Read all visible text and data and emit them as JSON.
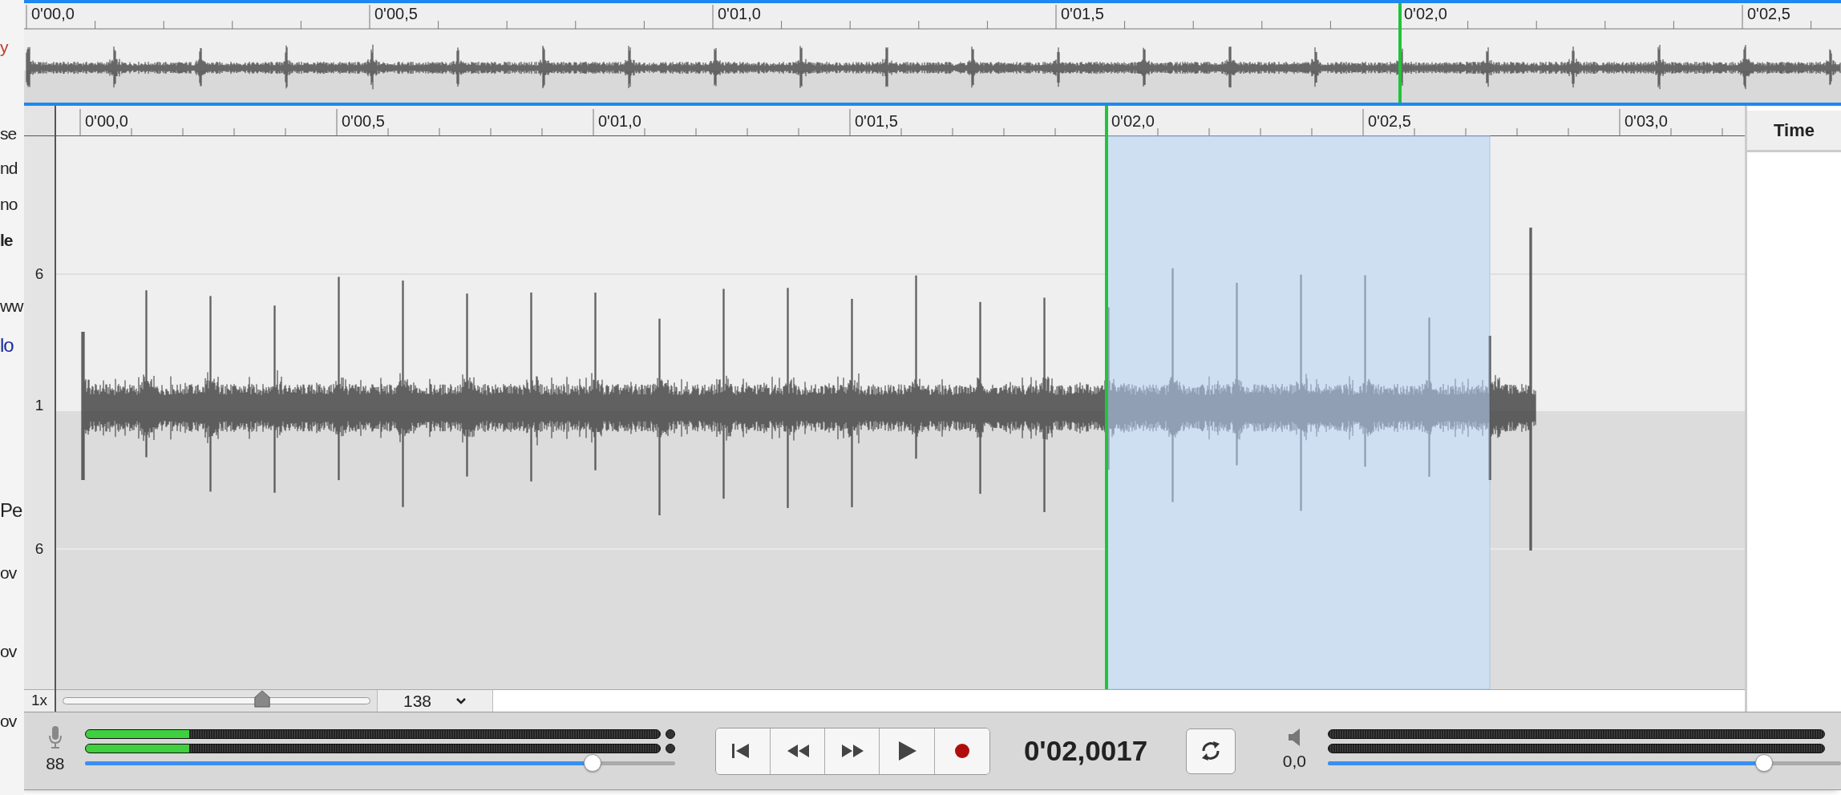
{
  "background_page": {
    "fragments": [
      {
        "text": "y",
        "kind": "accent"
      },
      {
        "text": "se",
        "kind": "plain"
      },
      {
        "text": "nd",
        "kind": "plain"
      },
      {
        "text": "no",
        "kind": "plain"
      },
      {
        "text": "le",
        "kind": "bold"
      },
      {
        "text": "ww",
        "kind": "plain"
      },
      {
        "text": "lo",
        "kind": "link"
      },
      {
        "text": "Pe",
        "kind": "heading"
      },
      {
        "text": "ov",
        "kind": "plain"
      },
      {
        "text": "ov",
        "kind": "plain"
      },
      {
        "text": "ov",
        "kind": "plain"
      }
    ]
  },
  "overview": {
    "ruler_labels": [
      "0'00,0",
      "0'00,5",
      "0'01,0",
      "0'01,5",
      "0'02,0",
      "0'02,5"
    ]
  },
  "main_view": {
    "ruler_labels": [
      "0'00,0",
      "0'00,5",
      "0'01,0",
      "0'01,5",
      "0'02,0",
      "0'02,5",
      "0'03,0"
    ],
    "axis_labels": [
      "6",
      "1",
      "6"
    ]
  },
  "side_panel": {
    "header": "Time"
  },
  "zoom": {
    "label": "1x",
    "level": 0.65,
    "value": "138"
  },
  "input": {
    "gain": "88",
    "level": 0.86,
    "meters": [
      {
        "level": 0.18
      },
      {
        "level": 0.18
      }
    ]
  },
  "time_display": "0'02,0017",
  "output": {
    "volume": "0,0",
    "level": 0.85,
    "meters": [
      {
        "level": 0
      },
      {
        "level": 0
      }
    ]
  }
}
